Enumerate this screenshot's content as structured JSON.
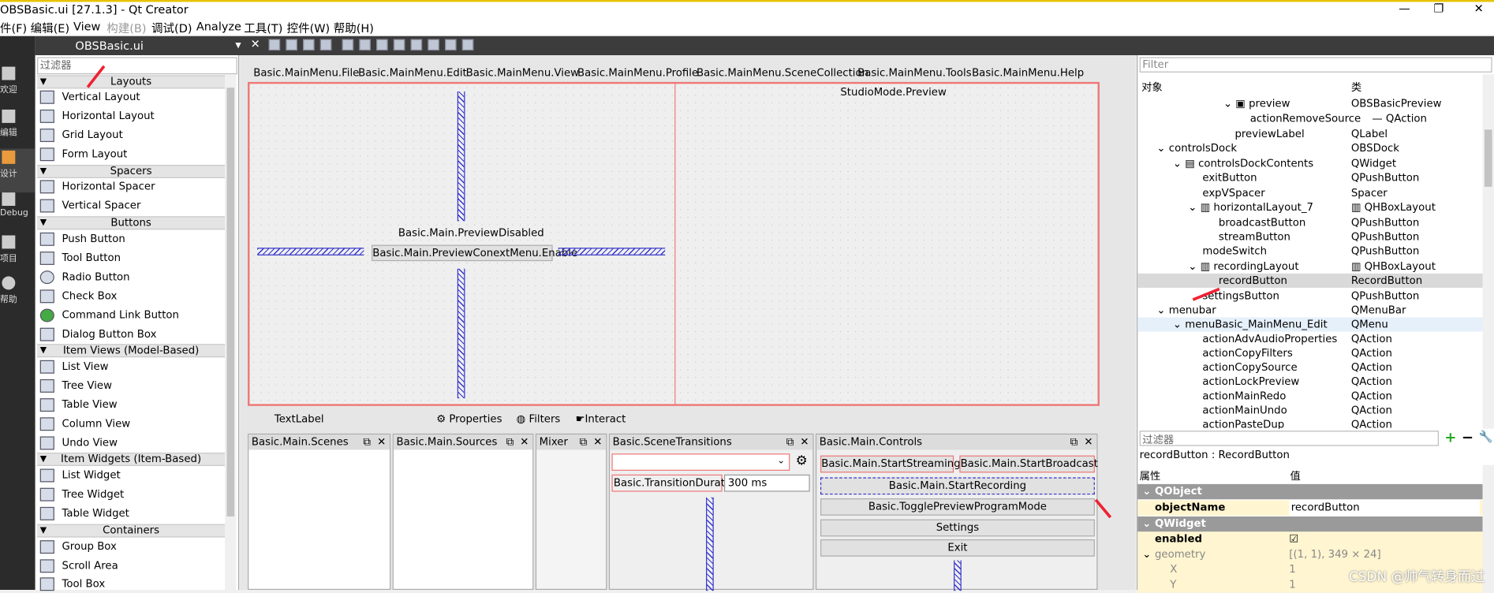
{
  "title": "OBSBasic.ui [27.1.3] - Qt Creator",
  "window_buttons": [
    "—",
    "❐",
    "✕"
  ],
  "menus": [
    "件(F)",
    "编辑(E)",
    "View",
    "构建(B)",
    "调试(D)",
    "Analyze",
    "工具(T)",
    "控件(W)",
    "帮助(H)"
  ],
  "modes": [
    "欢迎",
    "编辑",
    "设计",
    "Debug",
    "项目",
    "帮助"
  ],
  "file_name": "OBSBasic.ui",
  "widgetbox": {
    "filter_placeholder": "过滤器",
    "categories": [
      "Layouts",
      "Spacers",
      "Buttons",
      "Item Views (Model-Based)",
      "Item Widgets (Item-Based)",
      "Containers"
    ],
    "items": [
      "Vertical Layout",
      "Horizontal Layout",
      "Grid Layout",
      "Form Layout",
      "Horizontal Spacer",
      "Vertical Spacer",
      "Push Button",
      "Tool Button",
      "Radio Button",
      "Check Box",
      "Command Link Button",
      "Dialog Button Box",
      "List View",
      "Tree View",
      "Table View",
      "Column View",
      "Undo View",
      "List Widget",
      "Tree Widget",
      "Table Widget",
      "Group Box",
      "Scroll Area",
      "Tool Box"
    ]
  },
  "form": {
    "menus": [
      "Basic.MainMenu.File",
      "Basic.MainMenu.Edit",
      "Basic.MainMenu.View",
      "Basic.MainMenu.Profile",
      "Basic.MainMenu.SceneCollection",
      "Basic.MainMenu.Tools",
      "Basic.MainMenu.Help"
    ],
    "studio_preview": "StudioMode.Preview",
    "preview_disabled": "Basic.Main.PreviewDisabled",
    "preview_menu_enable": "Basic.Main.PreviewConextMenu.Enable",
    "textlabel": "TextLabel",
    "properties": "Properties",
    "filters": "Filters",
    "interact": "Interact",
    "docks": [
      "Basic.Main.Scenes",
      "Basic.Main.Sources",
      "Mixer",
      "Basic.SceneTransitions",
      "Basic.Main.Controls"
    ],
    "transition_duration": "Basic.TransitionDuration",
    "duration_value": "300 ms",
    "start_streaming": "Basic.Main.StartStreaming",
    "start_broadcast": "Basic.Main.StartBroadcast",
    "start_recording": "Basic.Main.StartRecording",
    "toggle_preview": "Basic.TogglePreviewProgramMode",
    "settings": "Settings",
    "exit": "Exit"
  },
  "object_inspector": {
    "filter_placeholder": "Filter",
    "col_object": "对象",
    "col_class": "类",
    "rows": [
      {
        "name": "preview",
        "cls": "OBSBasicPreview"
      },
      {
        "name": "actionRemoveSource",
        "cls": "— QAction"
      },
      {
        "name": "previewLabel",
        "cls": "QLabel"
      },
      {
        "name": "controlsDock",
        "cls": "OBSDock"
      },
      {
        "name": "controlsDockContents",
        "cls": "QWidget"
      },
      {
        "name": "exitButton",
        "cls": "QPushButton"
      },
      {
        "name": "expVSpacer",
        "cls": "Spacer"
      },
      {
        "name": "horizontalLayout_7",
        "cls": "QHBoxLayout"
      },
      {
        "name": "broadcastButton",
        "cls": "QPushButton"
      },
      {
        "name": "streamButton",
        "cls": "QPushButton"
      },
      {
        "name": "modeSwitch",
        "cls": "QPushButton"
      },
      {
        "name": "recordingLayout",
        "cls": "QHBoxLayout"
      },
      {
        "name": "recordButton",
        "cls": "RecordButton"
      },
      {
        "name": "settingsButton",
        "cls": "QPushButton"
      },
      {
        "name": "menubar",
        "cls": "QMenuBar"
      },
      {
        "name": "menuBasic_MainMenu_Edit",
        "cls": "QMenu"
      },
      {
        "name": "actionAdvAudioProperties",
        "cls": "QAction"
      },
      {
        "name": "actionCopyFilters",
        "cls": "QAction"
      },
      {
        "name": "actionCopySource",
        "cls": "QAction"
      },
      {
        "name": "actionLockPreview",
        "cls": "QAction"
      },
      {
        "name": "actionMainRedo",
        "cls": "QAction"
      },
      {
        "name": "actionMainUndo",
        "cls": "QAction"
      },
      {
        "name": "actionPasteDup",
        "cls": "QAction"
      }
    ]
  },
  "property_editor": {
    "filter_placeholder": "过滤器",
    "header": "recordButton : RecordButton",
    "col_prop": "属性",
    "col_value": "值",
    "rows": [
      {
        "k": "QObject",
        "v": ""
      },
      {
        "k": "objectName",
        "v": "recordButton"
      },
      {
        "k": "QWidget",
        "v": ""
      },
      {
        "k": "enabled",
        "v": "☑"
      },
      {
        "k": "geometry",
        "v": "[(1, 1), 349 × 24]"
      },
      {
        "k": "X",
        "v": "1"
      },
      {
        "k": "Y",
        "v": "1"
      }
    ]
  },
  "watermark": "CSDN @帅气转身而过"
}
